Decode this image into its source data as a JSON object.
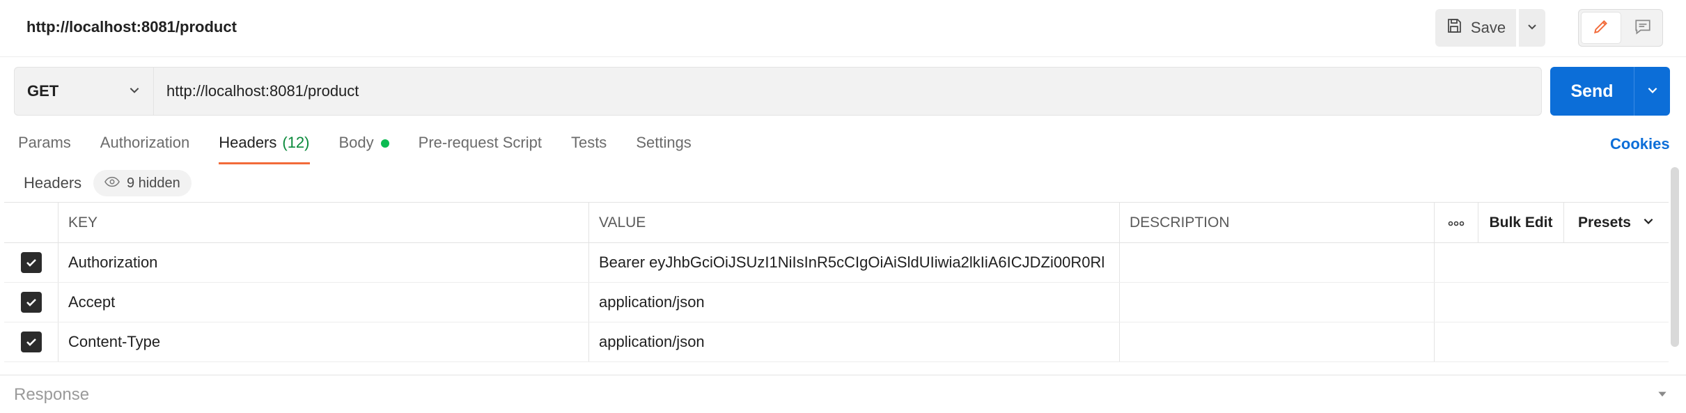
{
  "topbar": {
    "title": "http://localhost:8081/product",
    "save_label": "Save"
  },
  "request": {
    "method": "GET",
    "url": "http://localhost:8081/product",
    "send_label": "Send"
  },
  "tabs": [
    {
      "label": "Params"
    },
    {
      "label": "Authorization"
    },
    {
      "label": "Headers",
      "count": "(12)"
    },
    {
      "label": "Body"
    },
    {
      "label": "Pre-request Script"
    },
    {
      "label": "Tests"
    },
    {
      "label": "Settings"
    }
  ],
  "cookies_label": "Cookies",
  "headers_section": {
    "title": "Headers",
    "hidden_label": "9 hidden"
  },
  "table": {
    "columns": {
      "key": "KEY",
      "value": "VALUE",
      "description": "DESCRIPTION",
      "bulk_edit": "Bulk Edit",
      "presets": "Presets"
    },
    "rows": [
      {
        "key": "Authorization",
        "value": "Bearer eyJhbGciOiJSUzI1NiIsInR5cCIgOiAiSldUIiwia2lkIiA6ICJDZi00R0Rl",
        "description": ""
      },
      {
        "key": "Accept",
        "value": "application/json",
        "description": ""
      },
      {
        "key": "Content-Type",
        "value": "application/json",
        "description": ""
      }
    ]
  },
  "response": {
    "label": "Response"
  },
  "colors": {
    "accent": "#0c6ed8",
    "tab_indicator": "#f26b3a",
    "body_dot": "#0cbb52",
    "count_text": "#0a8a3b"
  }
}
